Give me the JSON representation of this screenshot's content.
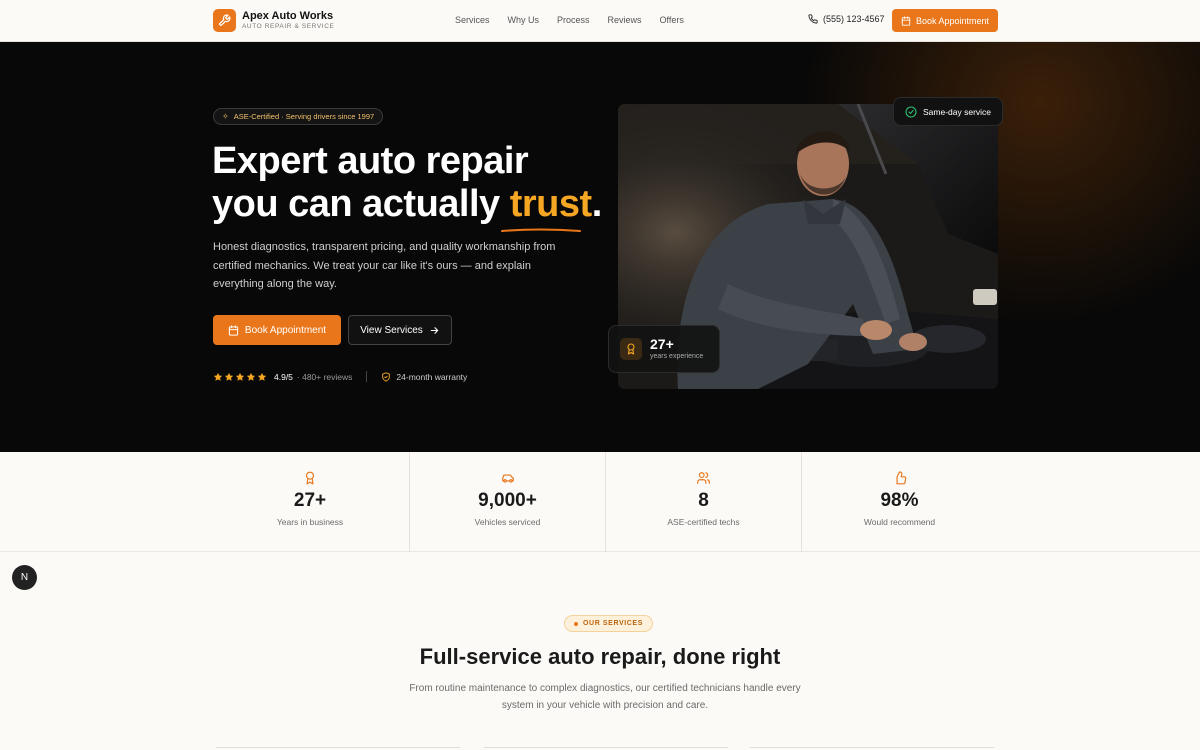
{
  "brand": {
    "name": "Apex Auto Works",
    "subtitle": "AUTO REPAIR & SERVICE"
  },
  "nav": {
    "links": [
      "Services",
      "Why Us",
      "Process",
      "Reviews",
      "Offers"
    ],
    "phone": "(555) 123-4567",
    "cta": "Book Appointment"
  },
  "hero": {
    "badge": "ASE-Certified · Serving drivers since 1997",
    "headline_1": "Expert auto repair",
    "headline_2": "you can actually ",
    "headline_accent": "trust",
    "headline_end": ".",
    "description": "Honest diagnostics, transparent pricing, and quality workmanship from certified mechanics. We treat your car like it's ours — and explain everything along the way.",
    "primary_cta": "Book Appointment",
    "secondary_cta": "View Services",
    "rating": "4.9/5",
    "reviews": "· 480+ reviews",
    "warranty": "24-month warranty",
    "same_day": "Same-day service",
    "years_value": "27+",
    "years_label": "years experience"
  },
  "stats": [
    {
      "icon": "award-icon",
      "value": "27+",
      "label": "Years in business"
    },
    {
      "icon": "car-icon",
      "value": "9,000+",
      "label": "Vehicles serviced"
    },
    {
      "icon": "users-icon",
      "value": "8",
      "label": "ASE-certified techs"
    },
    {
      "icon": "thumbs-up-icon",
      "value": "98%",
      "label": "Would recommend"
    }
  ],
  "fab": "N",
  "services": {
    "badge": "OUR SERVICES",
    "title": "Full-service auto repair, done right",
    "description": "From routine maintenance to complex diagnostics, our certified technicians handle every system in your vehicle with precision and care."
  },
  "colors": {
    "accent": "#e9761a",
    "accent_light": "#f5a623",
    "hero_bg": "#080808",
    "page_bg": "#fbfaf7"
  }
}
